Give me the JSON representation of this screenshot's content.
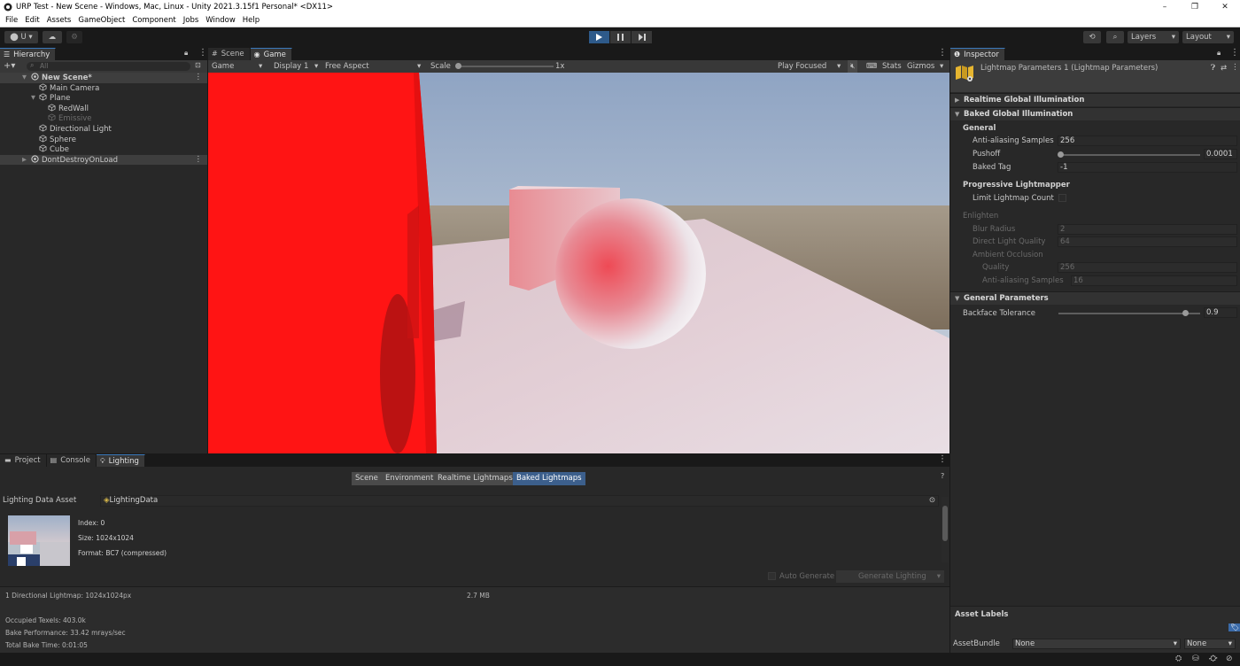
{
  "window": {
    "title": "URP Test - New Scene - Windows, Mac, Linux - Unity 2021.3.15f1 Personal* <DX11>",
    "controls": [
      "–",
      "❐",
      "✕"
    ]
  },
  "menu": [
    "File",
    "Edit",
    "Assets",
    "GameObject",
    "Component",
    "Jobs",
    "Window",
    "Help"
  ],
  "toolbar": {
    "account": "U ▾",
    "layers": "Layers",
    "layout": "Layout"
  },
  "hierarchy": {
    "tab": "Hierarchy",
    "search_placeholder": "All",
    "items": [
      {
        "label": "New Scene*",
        "kind": "scene"
      },
      {
        "label": "Main Camera",
        "kind": "object"
      },
      {
        "label": "Plane",
        "kind": "object"
      },
      {
        "label": "RedWall",
        "kind": "object"
      },
      {
        "label": "Emissive",
        "kind": "object"
      },
      {
        "label": "Directional Light",
        "kind": "object"
      },
      {
        "label": "Sphere",
        "kind": "object"
      },
      {
        "label": "Cube",
        "kind": "object"
      },
      {
        "label": "DontDestroyOnLoad",
        "kind": "scene"
      }
    ]
  },
  "gameview": {
    "tabs": [
      "Scene",
      "Game"
    ],
    "mode": "Game",
    "display": "Display 1",
    "aspect": "Free Aspect",
    "scale_label": "Scale",
    "scale_value": "1x",
    "play_mode": "Play Focused",
    "stats": "Stats",
    "gizmos": "Gizmos"
  },
  "bottom": {
    "tabs": [
      "Project",
      "Console",
      "Lighting"
    ],
    "subtabs": [
      "Scene",
      "Environment",
      "Realtime Lightmaps",
      "Baked Lightmaps"
    ],
    "lighting_data_label": "Lighting Data Asset",
    "lighting_data_value": "LightingData",
    "lightmap_index": "Index: 0",
    "lightmap_size": "Size: 1024x1024",
    "lightmap_format": "Format: BC7 (compressed)",
    "auto_generate": "Auto Generate",
    "generate_lighting": "Generate Lighting",
    "summary": "1 Directional Lightmap: 1024x1024px",
    "memory": "2.7 MB",
    "occupied": "Occupied Texels: 403.0k",
    "performance": "Bake Performance: 33.42 mrays/sec",
    "total_time": "Total Bake Time: 0:01:05"
  },
  "inspector": {
    "tab": "Inspector",
    "asset_title": "Lightmap Parameters 1 (Lightmap Parameters)",
    "sections": {
      "realtime": "Realtime Global Illumination",
      "baked": "Baked Global Illumination",
      "general_params": "General Parameters"
    },
    "general_label": "General",
    "aa_label": "Anti-aliasing Samples",
    "aa_value": "256",
    "pushoff_label": "Pushoff",
    "pushoff_value": "0.0001",
    "baked_tag_label": "Baked Tag",
    "baked_tag_value": "-1",
    "progressive_label": "Progressive Lightmapper",
    "limit_label": "Limit Lightmap Count",
    "enlighten_label": "Enlighten",
    "blur_label": "Blur Radius",
    "blur_value": "2",
    "dlq_label": "Direct Light Quality",
    "dlq_value": "64",
    "ao_label": "Ambient Occlusion",
    "quality_label": "Quality",
    "quality_value": "256",
    "aa2_label": "Anti-aliasing Samples",
    "aa2_value": "16",
    "backface_label": "Backface Tolerance",
    "backface_value": "0.9",
    "asset_labels": "Asset Labels",
    "assetbundle_label": "AssetBundle",
    "assetbundle_value": "None",
    "variant_value": "None"
  }
}
